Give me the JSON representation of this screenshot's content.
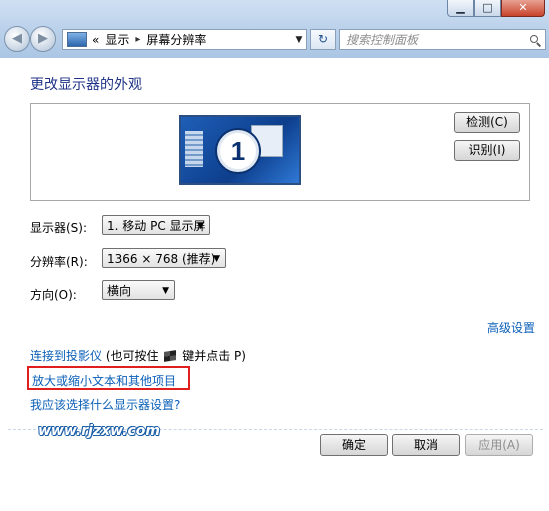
{
  "window": {
    "minimize": "▁",
    "maximize": "□",
    "close": "✕"
  },
  "nav": {
    "back_icon": "back-arrow-icon",
    "forward_icon": "forward-arrow-icon",
    "address": {
      "chevron": "«",
      "crumb1": "显示",
      "arrow": "▸",
      "crumb2": "屏幕分辨率"
    },
    "refresh_icon": "refresh-icon",
    "search_placeholder": "搜索控制面板"
  },
  "page": {
    "title": "更改显示器的外观",
    "monitor_number": "1",
    "detect_label": "检测(C)",
    "identify_label": "识别(I)",
    "display_label": "显示器(S):",
    "display_value": "1. 移动 PC 显示屏",
    "resolution_label": "分辨率(R):",
    "resolution_value": "1366 × 768 (推荐)",
    "orientation_label": "方向(O):",
    "orientation_value": "横向",
    "advanced_link": "高级设置",
    "projector_link": "连接到投影仪",
    "projector_hint_pre": "(也可按住",
    "projector_hint_post": "键并点击 P)",
    "enlarge_link": "放大或缩小文本和其他项目",
    "which_link": "我应该选择什么显示器设置?"
  },
  "watermark": "www.rjzxw.com",
  "footer": {
    "ok": "确定",
    "cancel": "取消",
    "apply": "应用(A)"
  }
}
